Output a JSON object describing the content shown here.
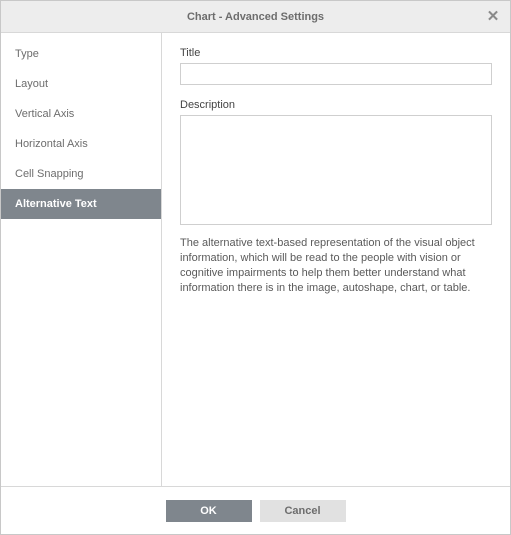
{
  "dialog": {
    "title": "Chart - Advanced Settings",
    "close_glyph": "✕"
  },
  "sidebar": {
    "items": [
      {
        "label": "Type"
      },
      {
        "label": "Layout"
      },
      {
        "label": "Vertical Axis"
      },
      {
        "label": "Horizontal Axis"
      },
      {
        "label": "Cell Snapping"
      },
      {
        "label": "Alternative Text"
      }
    ],
    "active_index": 5
  },
  "content": {
    "title_label": "Title",
    "title_value": "",
    "description_label": "Description",
    "description_value": "",
    "help_text": "The alternative text-based representation of the visual object information, which will be read to the people with vision or cognitive impairments to help them better understand what information there is in the image, autoshape, chart, or table."
  },
  "footer": {
    "ok_label": "OK",
    "cancel_label": "Cancel"
  }
}
